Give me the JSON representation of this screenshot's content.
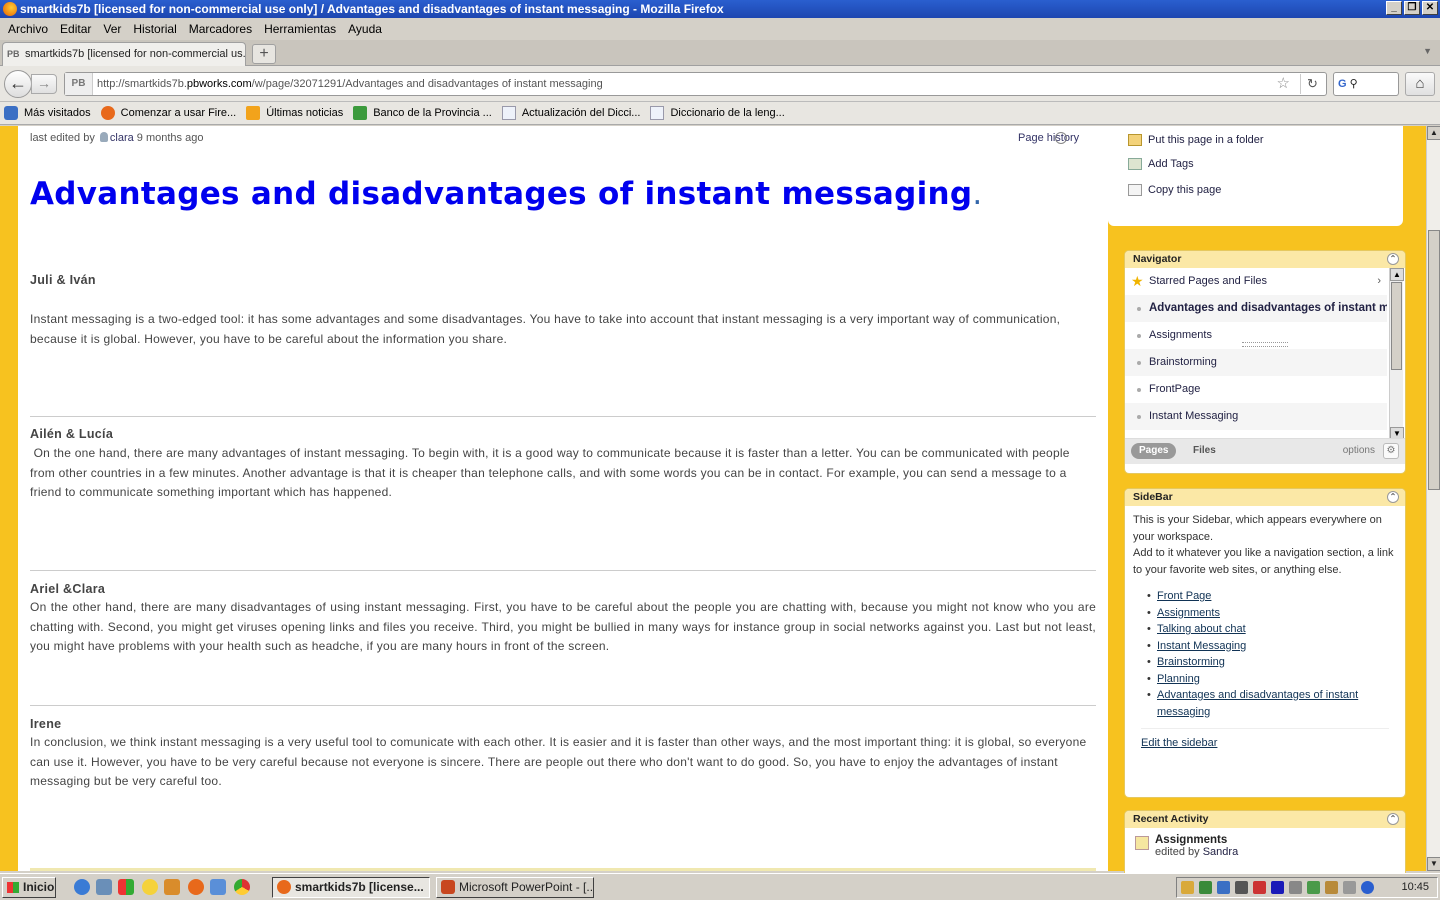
{
  "window": {
    "title": "smartkids7b [licensed for non-commercial use only] / Advantages and disadvantages of instant messaging - Mozilla Firefox",
    "controls": [
      "_",
      "❐",
      "✕"
    ]
  },
  "menu": [
    "Archivo",
    "Editar",
    "Ver",
    "Historial",
    "Marcadores",
    "Herramientas",
    "Ayuda"
  ],
  "tabs": {
    "active_label": "smartkids7b [licensed for non-commercial us...",
    "favicon_text": "PB",
    "new_tab": "+"
  },
  "nav": {
    "url_prefix": "http://smartkids7b.",
    "url_domain": "pbworks.com",
    "url_path": "/w/page/32071291/Advantages and disadvantages of instant  messaging",
    "favicon_text": "PB",
    "search_engine": "G"
  },
  "bookmarks": [
    {
      "label": "Más visitados",
      "color": "#3b6fc4"
    },
    {
      "label": "Comenzar a usar Fire...",
      "color": "#e8691b"
    },
    {
      "label": "Últimas noticias",
      "color": "#f2a31b"
    },
    {
      "label": "Banco de la Provincia ...",
      "color": "#3c9a3c"
    },
    {
      "label": "Actualización del Dicci...",
      "color": "#eef2fa"
    },
    {
      "label": "Diccionario de la leng...",
      "color": "#eef2fa"
    }
  ],
  "page": {
    "last_edited_prefix": "last edited by",
    "last_edited_user": "clara",
    "last_edited_time": "9 months ago",
    "page_history": "Page history",
    "title": "Advantages and disadvantages of instant messaging",
    "title_dot": ".",
    "sections": [
      {
        "author": "Juli & Iván",
        "text": "Instant messaging is a two-edged tool: it has some advantages and some disadvantages. You have to take into account that instant messaging is a very important way of communication, because it is global. However, you have to be careful about the information you share."
      },
      {
        "author": "Ailén & Lucía",
        "text": " On the one hand, there are many advantages of instant messaging. To begin with, it is a good way to communicate because it is faster than a letter. You can be communicated with people from other countries in a few minutes. Another advantage is that it is cheaper than telephone calls, and with some words you can be in contact. For example, you can send a message to a friend to communicate something important which has happened."
      },
      {
        "author": "Ariel &Clara",
        "text": "On the other hand, there are many disadvantages of using instant messaging. First, you have to be careful about the people you are chatting with, because you might not know who you are chatting with. Second, you might get viruses opening links and files you receive. Third, you might be bullied in many ways for instance group in social networks against you. Last but not least, you might have problems with your health such as headche, if you are many hours in front of the screen."
      },
      {
        "author": "Irene",
        "text": "In conclusion, we think instant messaging is a very useful tool to comunicate with each other. It is easier and it is faster than other ways, and the most important thing: it is global, so everyone can use it. However, you have to be very careful because not everyone is sincere. There are people out there who don't want to do good. So, you have to enjoy the advantages of instant messaging but be very careful too."
      }
    ]
  },
  "page_actions": [
    "Put this page in a folder",
    "Add Tags",
    "Copy this page"
  ],
  "navigator": {
    "title": "Navigator",
    "starred": "Starred Pages and Files",
    "items": [
      "Advantages and disadvantages of instant messaging",
      "Assignments",
      "Brainstorming",
      "FrontPage",
      "Instant Messaging"
    ],
    "tab_pages": "Pages",
    "tab_files": "Files",
    "options": "options"
  },
  "sidebar": {
    "title": "SideBar",
    "intro_1": "This is your Sidebar, which appears everywhere on your workspace.",
    "intro_2": "Add to it whatever you like a navigation section, a link to your favorite web sites, or anything else.",
    "links": [
      "Front Page",
      "Assignments",
      "Talking about chat",
      "Instant Messaging",
      "Brainstorming",
      "Planning",
      "Advantages and disadvantages of instant messaging"
    ],
    "edit_link": "Edit the sidebar"
  },
  "recent_activity": {
    "title": "Recent Activity",
    "item_title": "Assignments",
    "item_prefix": "edited by",
    "item_user": "Sandra"
  },
  "taskbar": {
    "start": "Inicio",
    "tasks": [
      "smartkids7b [license...",
      "Microsoft PowerPoint - [..."
    ],
    "time": "10:45"
  }
}
